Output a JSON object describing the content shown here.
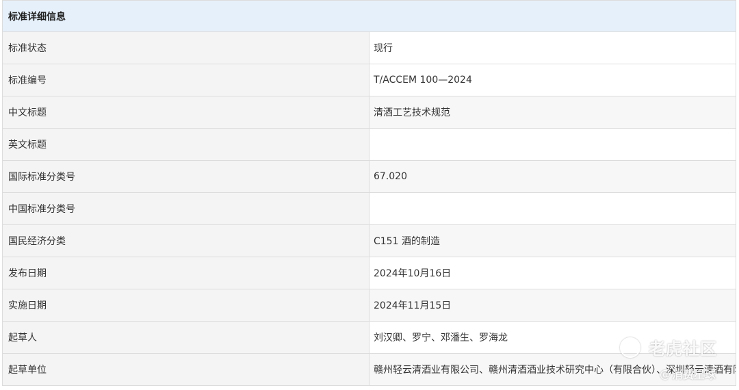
{
  "table": {
    "header": "标准详细信息",
    "rows": [
      {
        "label": "标准状态",
        "value": "现行"
      },
      {
        "label": "标准编号",
        "value": "T/ACCEM 100—2024"
      },
      {
        "label": "中文标题",
        "value": "清酒工艺技术规范"
      },
      {
        "label": "英文标题",
        "value": ""
      },
      {
        "label": "国际标准分类号",
        "value": "67.020"
      },
      {
        "label": "中国标准分类号",
        "value": ""
      },
      {
        "label": "国民经济分类",
        "value": "C151 酒的制造"
      },
      {
        "label": "发布日期",
        "value": "2024年10月16日"
      },
      {
        "label": "实施日期",
        "value": "2024年11月15日"
      },
      {
        "label": "起草人",
        "value": "刘汉卿、罗宁、邓潘生、罗海龙"
      },
      {
        "label": "起草单位",
        "value": "赣州轻云清酒业有限公司、赣州清酒酒业技术研究中心（有限合伙）、深圳轻云清酒有限公司、中山轻云云起酒业有限公司"
      }
    ]
  },
  "watermark": {
    "brand": "老虎社区",
    "at": "@",
    "handle": "消费星球",
    "icon": "tiger-logo-icon"
  }
}
